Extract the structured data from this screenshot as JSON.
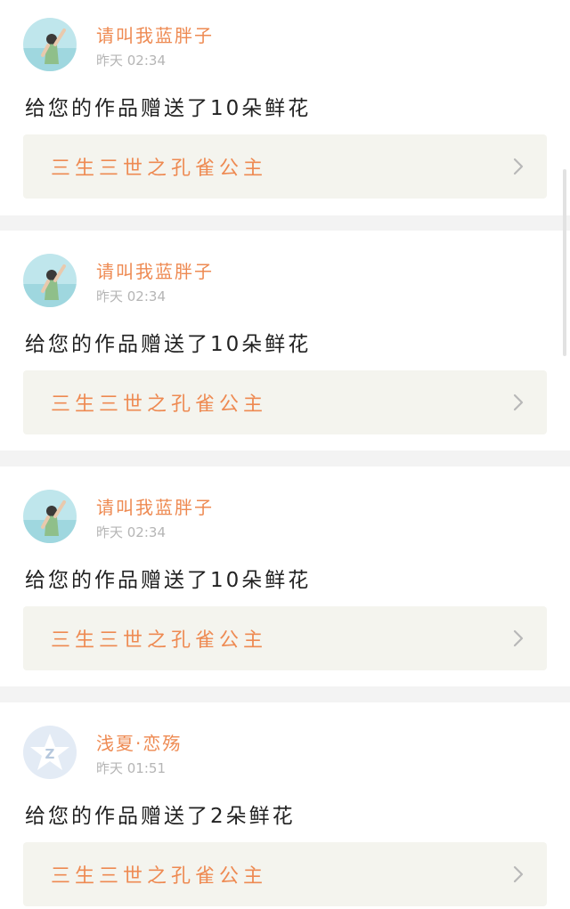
{
  "notifications": [
    {
      "avatar": "beach-girl-avatar",
      "username": "请叫我蓝胖子",
      "time": "昨天 02:34",
      "message": "给您的作品赠送了10朵鲜花",
      "work_title": "三生三世之孔雀公主"
    },
    {
      "avatar": "beach-girl-avatar",
      "username": "请叫我蓝胖子",
      "time": "昨天 02:34",
      "message": "给您的作品赠送了10朵鲜花",
      "work_title": "三生三世之孔雀公主"
    },
    {
      "avatar": "beach-girl-avatar",
      "username": "请叫我蓝胖子",
      "time": "昨天 02:34",
      "message": "给您的作品赠送了10朵鲜花",
      "work_title": "三生三世之孔雀公主"
    },
    {
      "avatar": "default-star-avatar",
      "username": "浅夏·恋殇",
      "time": "昨天 01:51",
      "message": "给您的作品赠送了2朵鲜花",
      "work_title": "三生三世之孔雀公主"
    }
  ],
  "colors": {
    "accent": "#ee8a52",
    "link_bg": "#f4f4ee",
    "separator": "#f3f3f3"
  },
  "icons": {
    "work_link": "chevron-right-icon"
  }
}
